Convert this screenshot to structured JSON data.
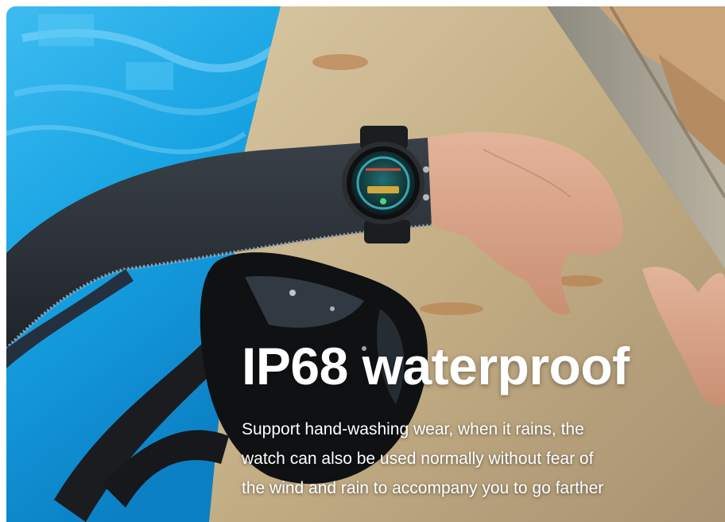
{
  "banner": {
    "headline": "IP68 waterproof",
    "description_lines": [
      "Support hand-washing wear, when it rains, the",
      "watch can also be used normally without fear of",
      "the wind and rain to accompany you to go farther"
    ]
  },
  "colors": {
    "pool_water": "#1aa7e6",
    "stone_ledge": "#c8b48e",
    "wetsuit": "#2c3138",
    "text": "#ffffff"
  }
}
